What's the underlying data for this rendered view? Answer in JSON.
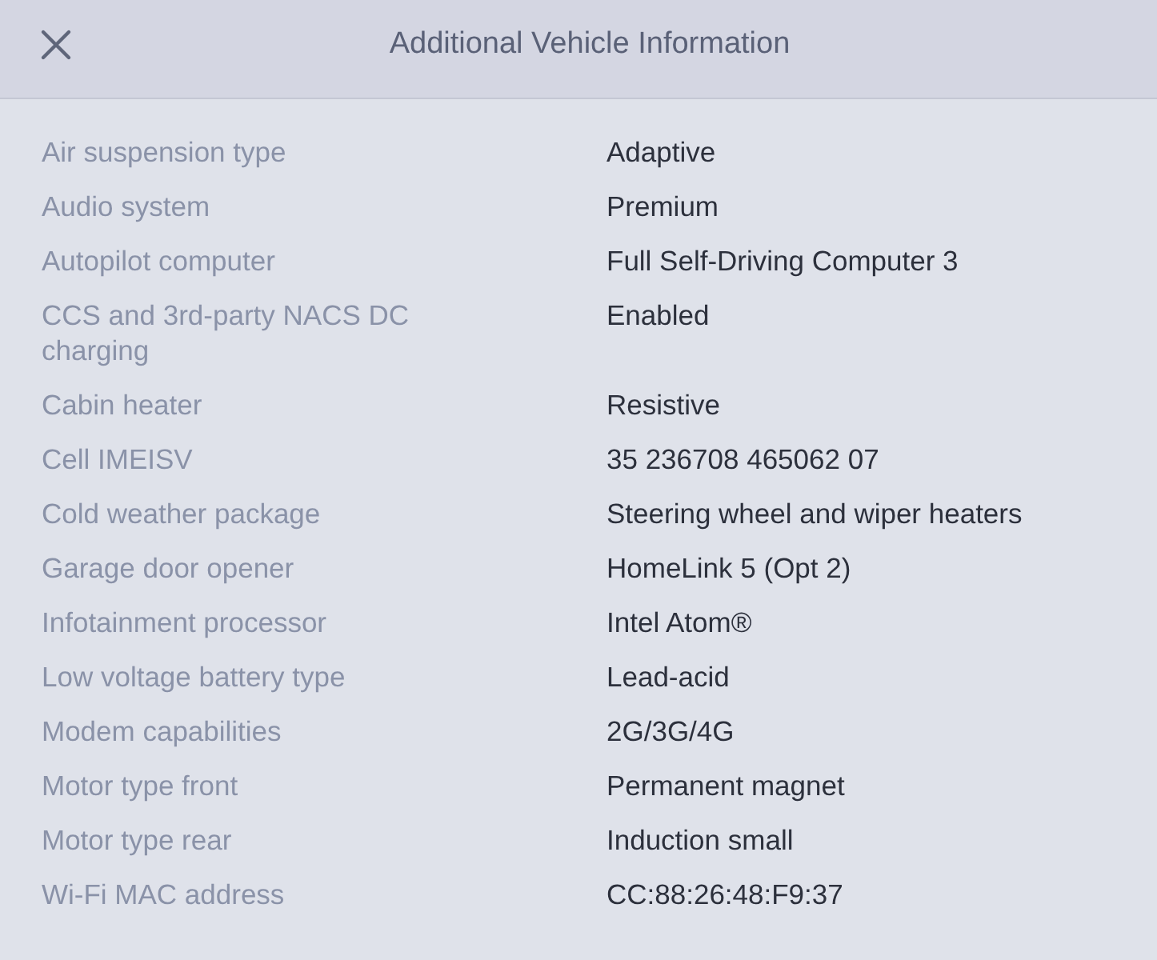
{
  "header": {
    "title": "Additional Vehicle Information"
  },
  "rows": [
    {
      "label": "Air suspension type",
      "value": "Adaptive"
    },
    {
      "label": "Audio system",
      "value": "Premium"
    },
    {
      "label": "Autopilot computer",
      "value": "Full Self-Driving Computer 3"
    },
    {
      "label": "CCS and 3rd-party NACS DC charging",
      "value": "Enabled"
    },
    {
      "label": "Cabin heater",
      "value": "Resistive"
    },
    {
      "label": "Cell IMEISV",
      "value": "35 236708 465062 07"
    },
    {
      "label": "Cold weather package",
      "value": "Steering wheel and wiper heaters"
    },
    {
      "label": "Garage door opener",
      "value": "HomeLink 5 (Opt 2)"
    },
    {
      "label": "Infotainment processor",
      "value": "Intel Atom®"
    },
    {
      "label": "Low voltage battery type",
      "value": "Lead-acid"
    },
    {
      "label": "Modem capabilities",
      "value": "2G/3G/4G"
    },
    {
      "label": "Motor type front",
      "value": "Permanent magnet"
    },
    {
      "label": "Motor type rear",
      "value": "Induction small"
    },
    {
      "label": "Wi-Fi MAC address",
      "value": "CC:88:26:48:F9:37"
    }
  ]
}
